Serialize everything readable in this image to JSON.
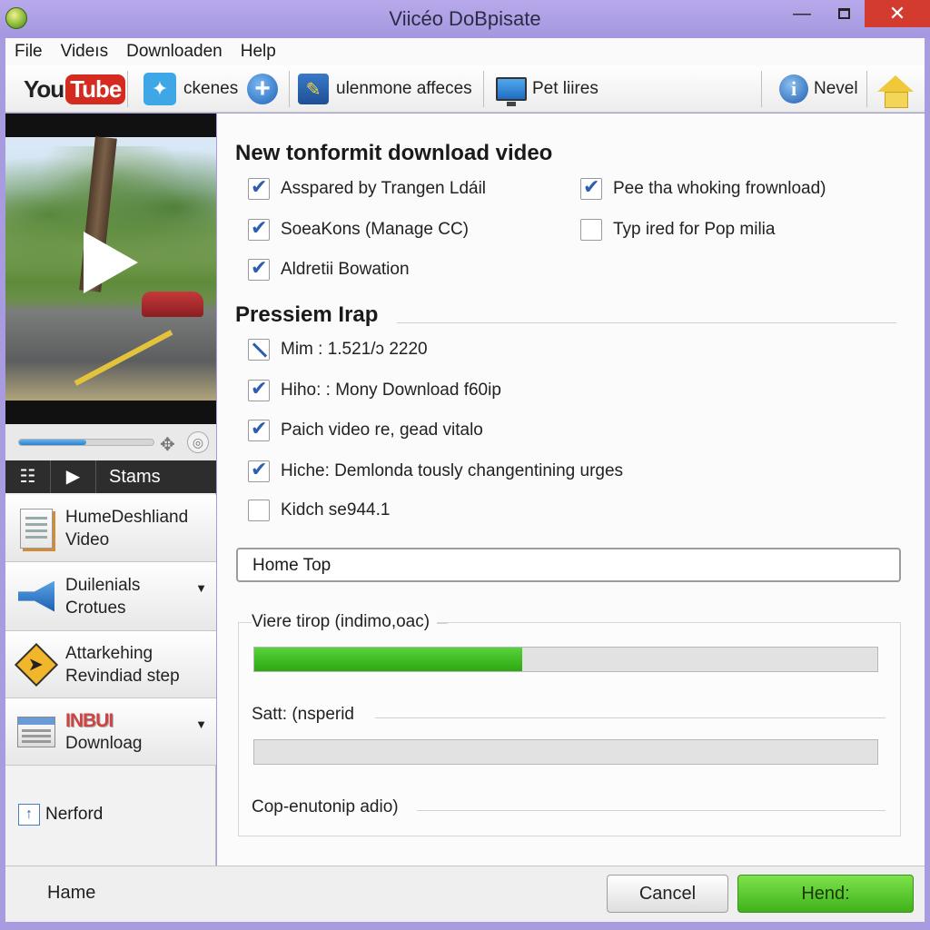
{
  "window": {
    "title": "Viicéo DoBpisate"
  },
  "menu": [
    "File",
    "Videıs",
    "Downloaden",
    "Help"
  ],
  "toolbar": {
    "youtube_you": "You",
    "youtube_tube": "Tube",
    "twitter_label": "ckenes",
    "edit_label": "ulenmone affeces",
    "monitor_label": "Pet liires",
    "info_label": "Nevel"
  },
  "player": {
    "seek_progress": 0.5,
    "controls_label": "Stams"
  },
  "sidebar": {
    "items": [
      {
        "label_line1": "HumeDeshliand",
        "label_line2": "Video",
        "icon": "document-icon"
      },
      {
        "label_line1": "Duilenials",
        "label_line2": "Crotues",
        "icon": "megaphone-icon"
      },
      {
        "label_line1": "Attarkehing",
        "label_line2": "Revindiad step",
        "icon": "warning-sign-icon"
      },
      {
        "label_line1": "INBUI",
        "label_line2": "Downloag",
        "icon": "window-icon"
      }
    ],
    "bottom_link": "Nerford"
  },
  "main": {
    "heading1": "New tonformit download video",
    "options_left": [
      {
        "label": "Asspared by Trangen Ldáil",
        "state": "checked"
      },
      {
        "label": "SoeaKons (Manage CC)",
        "state": "checked"
      },
      {
        "label": "Aldretii Bowation",
        "state": "checked"
      }
    ],
    "options_right": [
      {
        "label": "Pee tha whoking frownload)",
        "state": "checked"
      },
      {
        "label": "Typ ired for Pop milia",
        "state": "unchecked"
      }
    ],
    "heading2": "Pressiem Irap",
    "options2": [
      {
        "label": "Mim : 1.521/ɔ 2220",
        "state": "partial"
      },
      {
        "label": "Hiho: : Mony Download f60ip",
        "state": "checked"
      },
      {
        "label": "Paich video re, gead vitalo",
        "state": "checked"
      },
      {
        "label": "Hiche: Demlonda tously changentining urges",
        "state": "checked"
      },
      {
        "label": "Kidch se944.1",
        "state": "unchecked"
      }
    ],
    "input_value": "Home Top",
    "progress": [
      {
        "label": "Viere tirop (indimo,oac)",
        "value": 0.43
      },
      {
        "label": "Satt: (nsperid",
        "value": 0
      }
    ],
    "footer_label": "Cop-enutonip adio)"
  },
  "bottom": {
    "left_label": "Hame",
    "cancel_label": "Cancel",
    "send_label": "Hend:"
  },
  "colors": {
    "titlebar": "#a99be0",
    "progress_green": "#3fb21c",
    "close_red": "#d43b2f"
  }
}
